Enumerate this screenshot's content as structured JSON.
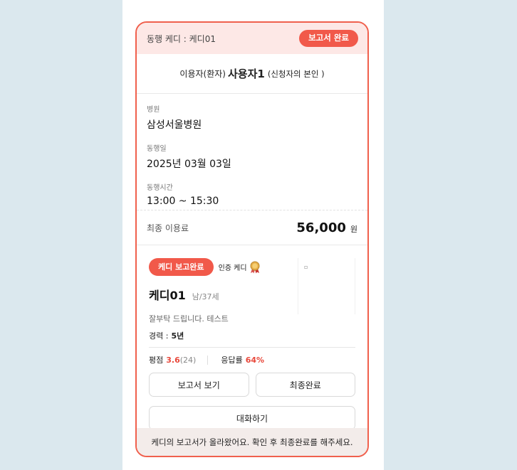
{
  "header": {
    "caddie_label": "동행 케디 : 케디01",
    "status_badge": "보고서 완료"
  },
  "user": {
    "prefix": "이용자(환자)",
    "name": "사용자1",
    "note": "(신청자의 본인 )"
  },
  "info": {
    "hospital_label": "병원",
    "hospital_value": "삼성서울병원",
    "date_label": "동행일",
    "date_value": "2025년 03월 03일",
    "time_label": "동행시간",
    "time_value": "13:00 ~ 15:30"
  },
  "fee": {
    "label": "최종 이용료",
    "amount": "56,000",
    "unit": "원"
  },
  "caddie": {
    "report_badge": "케디 보고완료",
    "cert_label": "인증 케디",
    "medal_icon": "medal-icon",
    "name": "케디01",
    "meta": "남/37세",
    "intro": "잘부탁 드립니다. 테스트",
    "career_label": "경력 :",
    "career_value": "5년",
    "rating_label": "평점",
    "rating_value": "3.6",
    "rating_count": "(24)",
    "response_label": "응답률",
    "response_value": "64%"
  },
  "buttons": {
    "view_report": "보고서 보기",
    "final_complete": "최종완료",
    "chat": "대화하기"
  },
  "footer": {
    "message": "케디의 보고서가 올라왔어요. 확인 후 최종완료를 해주세요."
  },
  "colors": {
    "accent": "#f1594a",
    "border": "#f0604d",
    "header_bg": "#fde8e6",
    "page_bg": "#dbe8ee"
  }
}
